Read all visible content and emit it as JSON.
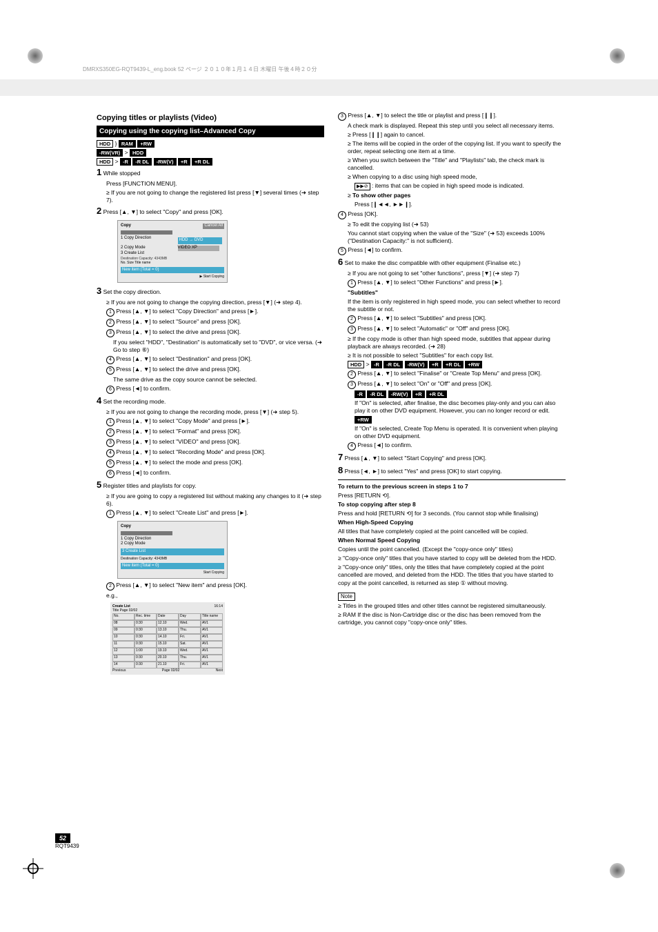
{
  "header_meta": "DMRXS350EG-RQT9439-L_eng.book  52 ページ  ２０１０年１月１４日  木曜日  午後４時２０分",
  "page_title_region": "Copying titles or playlists (Video)",
  "left": {
    "sec1_title": "Copying using the copying list–Advanced Copy",
    "media_row1": {
      "a": "HDD",
      "sep": "}",
      "b": "RAM",
      "c": "+RW"
    },
    "media_row2": {
      "a": "-RW(VR)",
      "sep": ">",
      "b": "HDD"
    },
    "media_row3": {
      "a": "HDD",
      "sep": ">",
      "b": "-R",
      "c": "-R DL",
      "d": "-RW(V)",
      "e": "+R",
      "f": "+R DL"
    },
    "step1": "While stopped",
    "step1_body": "Press [FUNCTION MENU].",
    "step2": "Press [▲, ▼] to select \"Copy\" and press [OK].",
    "bullet1": "If you are not going to change the registered list press [▼] several times (➜ step 7).",
    "step3": "Set the copy direction.",
    "bullet3a": "If you are not going to change the copying direction, press [▼] (➜ step 4).",
    "s3_1": "Press [▲, ▼] to select \"Copy Direction\" and press [►].",
    "s3_2": "Press [▲, ▼] to select \"Source\" and press [OK].",
    "s3_3": "Press [▲, ▼] to select the drive and press [OK].",
    "s3_note": "If you select \"HDD\", \"Destination\" is automatically set to \"DVD\", or vice versa. (➜ Go to step ⑥)",
    "s3_4": "Press [▲, ▼] to select \"Destination\" and press [OK].",
    "s3_5": "Press [▲, ▼] to select the drive and press [OK].",
    "s3_5_note": "The same drive as the copy source cannot be selected.",
    "s3_6": "Press [◄] to confirm.",
    "step4": "Set the recording mode.",
    "bullet4a": "If you are not going to change the recording mode, press [▼] (➜ step 5).",
    "s4_1": "Press [▲, ▼] to select \"Copy Mode\" and press [►].",
    "s4_2": "Press [▲, ▼] to select \"Format\" and press [OK].",
    "s4_3": "Press [▲, ▼] to select \"VIDEO\" and press [OK].",
    "s4_4": "Press [▲, ▼] to select \"Recording Mode\" and press [OK].",
    "s4_5": "Press [▲, ▼] to select the mode and press [OK].",
    "s4_6": "Press [◄] to confirm.",
    "step5": "Register titles and playlists for copy.",
    "bullet5a": "If you are going to copy a registered list without making any changes to it (➜ step 6).",
    "s5_1": "Press [▲, ▼] to select \"Create List\" and press [►].",
    "s5_2": "Press [▲, ▼] to select \"New item\" and press [OK].",
    "mock1": {
      "title": "Copy",
      "cancel": "Cancel All",
      "dir_lbl": "1 Copy Direction",
      "dir_val": "HDD → DVD",
      "mode_lbl": "2 Copy Mode",
      "mode_val": "VIDEO    XP",
      "list_lbl": "3 Create List",
      "dest": "Destination  Capacity: 4343MB",
      "no": "No.    Size    Title name",
      "newitem": "New item (Total = 0)",
      "start": "Start Copying"
    },
    "mock2_caption": "e.g.,",
    "mock2": {
      "title": "Create List",
      "time": "16:14",
      "subtitle": "Title      Page 02/02",
      "headers": [
        "No.",
        "Rec. time",
        "Date",
        "Day",
        "Title name"
      ],
      "r1": [
        "08",
        "0:30",
        "12.10",
        "Wed.",
        "AV1"
      ],
      "r2": [
        "09",
        "0:30",
        "13.10",
        "Thu.",
        "AV1"
      ],
      "r3": [
        "10",
        "0:30",
        "14.10",
        "Fri.",
        "AV1"
      ],
      "r4": [
        "11",
        "0:30",
        "15.10",
        "Sat.",
        "AV1"
      ],
      "r5": [
        "12",
        "1:00",
        "19.10",
        "Wed.",
        "AV1"
      ],
      "r6": [
        "13",
        "0:30",
        "20.10",
        "Thu.",
        "AV1"
      ],
      "r7": [
        "14",
        "0:30",
        "21.10",
        "Fri.",
        "AV1"
      ],
      "bottom_prev": "Previous",
      "bottom_next": "Next",
      "bottom_page": "Page 02/02"
    }
  },
  "right": {
    "r_s3": "Press [▲, ▼] to select the title or playlist and press [❙❙].",
    "r_s3_note": "A check mark is displayed. Repeat this step until you select all necessary items.",
    "r_s3_b1": "Press [❙❙] again to cancel.",
    "r_s3_b2": "The items will be copied in the order of the copying list. If you want to specify the order, repeat selecting one item at a time.",
    "r_s3_b3": "When you switch between the \"Title\" and \"Playlists\" tab, the check mark is cancelled.",
    "r_s3_b4": "When copying to a disc using high speed mode,",
    "r_s3_b4_indicates": ": items that can be copied in high speed mode is indicated.",
    "r_s3_to_show": "To show other pages",
    "r_s3_pages": "Press [❙◄◄, ►►❙].",
    "r_s4": "Press [OK].",
    "r_s4_b1": "To edit the copying list (➜ 53)",
    "r_s4_note": "You cannot start copying when the value of the \"Size\" (➜ 53) exceeds 100% (\"Destination Capacity:\" is not sufficient).",
    "r_s5": "Press [◄] to confirm.",
    "step6": "Set to make the disc compatible with other equipment (Finalise etc.)",
    "r6_b1": "If you are not going to set \"other functions\", press [▼] (➜ step 7)",
    "r6_1": "Press [▲, ▼] to select \"Other Functions\" and press [►].",
    "r6_subtitle_line": "\"Subtitles\"",
    "r6_subtitle_note": "If the item is only registered in high speed mode, you can select whether to record the subtitle or not.",
    "r6_2": "Press [▲, ▼] to select \"Subtitles\" and press [OK].",
    "r6_3": "Press [▲, ▼] to select \"Automatic\" or \"Off\" and press [OK].",
    "r6_b2": "If the copy mode is other than high speed mode, subtitles that appear during playback are always recorded. (➜ 28)",
    "r6_b3": "It is not possible to select \"Subtitles\" for each copy list.",
    "r6_media": {
      "a": "HDD",
      "sep": ">",
      "b": "-R",
      "c": "-R DL",
      "d": "-RW(V)",
      "e": "+R",
      "f": "+R DL",
      "g": "+RW"
    },
    "r6_22": "Press [▲, ▼] to select \"Finalise\" or \"Create Top Menu\" and press [OK].",
    "r6_33": "Press [▲, ▼] to select \"On\" or \"Off\" and press [OK].",
    "r6_media2": [
      "-R",
      "-R DL",
      "-RW(V)",
      "+R",
      "+R DL"
    ],
    "r6_fin_on": "If \"On\" is selected, after finalise, the disc becomes play-only and you can also play it on other DVD equipment. However, you can no longer record or edit.",
    "r6_media3": [
      "+RW"
    ],
    "r6_rw_on": "If \"On\" is selected, Create Top Menu is operated. It is convenient when playing on other DVD equipment.",
    "r6_4": "Press [◄] to confirm.",
    "step7": "Press [▲, ▼] to select \"Start Copying\" and press [OK].",
    "step8": "Press [◄, ►] to select \"Yes\" and press [OK] to start copying.",
    "hr_title": "To return to the previous screen in steps 1 to 7",
    "hr_body": "Press [RETURN ⟲].",
    "stop_title": "To stop copying after step 8",
    "stop_body": "Press and hold [RETURN ⟲] for 3 seconds. (You cannot stop while finalising)",
    "stop_sub": "When High-Speed Copying",
    "stop_sub_body": "All titles that have completely copied at the point cancelled will be copied.",
    "stop_sub2": "When Normal Speed Copying",
    "stop_sub2_body": "Copies until the point cancelled. (Except the \"copy-once only\" titles)",
    "stop_b1": "\"Copy-once only\" titles that you have started to copy will be deleted from the HDD.",
    "stop_b2": "\"Copy-once only\" titles, only the titles that have completely copied at the point cancelled are moved, and deleted from the HDD. The titles that you have started to copy at the point cancelled, is returned as step ① without moving.",
    "note_title": "Note",
    "note_b1": "Titles in the grouped titles and other titles cannot be registered simultaneously.",
    "note_b2": "RAM If the disc is Non-Cartridge disc or the disc has been removed from the cartridge, you cannot copy \"copy-once only\" titles."
  },
  "footer": {
    "page": "52",
    "code": "RQT9439"
  }
}
